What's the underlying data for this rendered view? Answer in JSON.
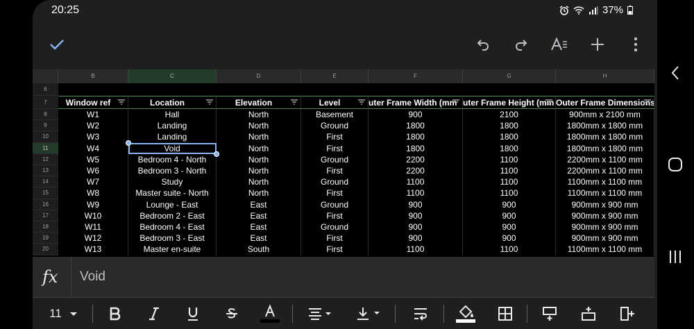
{
  "status_bar": {
    "time": "20:25",
    "battery": "37%",
    "icons": [
      "alarm-icon",
      "wifi-icon",
      "signal-icon",
      "battery-icon"
    ]
  },
  "toolbar": {
    "icons": [
      "check-icon",
      "undo-icon",
      "redo-icon",
      "text-format-icon",
      "insert-icon",
      "more-icon"
    ]
  },
  "sheet": {
    "column_letters": [
      "B",
      "C",
      "D",
      "E",
      "F",
      "G",
      "H"
    ],
    "row_numbers": [
      "6",
      "7",
      "8",
      "9",
      "10",
      "11",
      "12",
      "13",
      "14",
      "15",
      "16",
      "17",
      "18",
      "19",
      "20"
    ],
    "headers": [
      "Window ref",
      "Location",
      "Elevation",
      "Level",
      "uter Frame Width (mm",
      "uter Frame Height (mm",
      "Outer Frame Dimensions"
    ],
    "rows": [
      [
        "W1",
        "Hall",
        "North",
        "Basement",
        "900",
        "2100",
        "900mm x 2100 mm"
      ],
      [
        "W2",
        "Landing",
        "North",
        "Ground",
        "1800",
        "1800",
        "1800mm x 1800 mm"
      ],
      [
        "W3",
        "Landing",
        "North",
        "First",
        "1800",
        "1800",
        "1800mm x 1800 mm"
      ],
      [
        "W4",
        "Void",
        "North",
        "First",
        "1800",
        "1800",
        "1800mm x 1800 mm"
      ],
      [
        "W5",
        "Bedroom 4 - North",
        "North",
        "Ground",
        "2200",
        "1100",
        "2200mm x 1100 mm"
      ],
      [
        "W6",
        "Bedroom 3 - North",
        "North",
        "First",
        "2200",
        "1100",
        "2200mm x 1100 mm"
      ],
      [
        "W7",
        "Study",
        "North",
        "Ground",
        "1100",
        "1100",
        "1100mm x 1100 mm"
      ],
      [
        "W8",
        "Master suite - North",
        "North",
        "First",
        "1100",
        "1100",
        "1100mm x 1100 mm"
      ],
      [
        "W9",
        "Lounge - East",
        "East",
        "Ground",
        "900",
        "900",
        "900mm x 900 mm"
      ],
      [
        "W10",
        "Bedroom 2 - East",
        "East",
        "First",
        "900",
        "900",
        "900mm x 900 mm"
      ],
      [
        "W11",
        "Bedroom 4 - East",
        "East",
        "Ground",
        "900",
        "900",
        "900mm x 900 mm"
      ],
      [
        "W12",
        "Bedroom 3 - East",
        "East",
        "First",
        "900",
        "900",
        "900mm x 900 mm"
      ],
      [
        "W13",
        "Master en-suite",
        "South",
        "First",
        "1100",
        "1100",
        "1100mm x 1100 mm"
      ]
    ],
    "selected_cell": "C11"
  },
  "formula_bar": {
    "label": "fx",
    "value": "Void"
  },
  "format_bar": {
    "font_size": "11",
    "icons": [
      "bold-icon",
      "italic-icon",
      "underline-icon",
      "strikethrough-icon",
      "text-color-icon",
      "horizontal-align-icon",
      "vertical-align-icon",
      "text-wrap-icon",
      "fill-color-icon",
      "borders-icon",
      "insert-row-above-icon",
      "insert-row-below-icon",
      "insert-column-icon"
    ]
  },
  "colors": {
    "accent": "#8ab4f8",
    "header_border": "#4b8a4b",
    "background": "#000000"
  }
}
